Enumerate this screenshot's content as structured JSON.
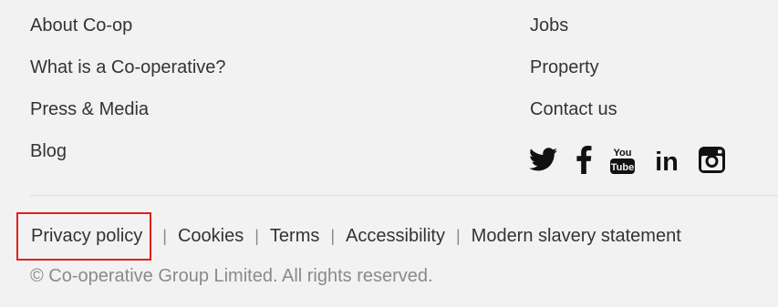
{
  "footer": {
    "left_links": [
      {
        "label": "About Co-op"
      },
      {
        "label": "What is a Co-operative?"
      },
      {
        "label": "Press & Media"
      },
      {
        "label": "Blog"
      }
    ],
    "right_links": [
      {
        "label": "Jobs"
      },
      {
        "label": "Property"
      },
      {
        "label": "Contact us"
      }
    ],
    "social": [
      {
        "icon": "twitter-icon"
      },
      {
        "icon": "facebook-icon"
      },
      {
        "icon": "youtube-icon"
      },
      {
        "icon": "linkedin-icon"
      },
      {
        "icon": "instagram-icon"
      }
    ],
    "youtube_text_top": "You",
    "youtube_text_bottom": "Tube",
    "linkedin_text": "in",
    "legal_links": [
      {
        "label": "Privacy policy"
      },
      {
        "label": "Cookies"
      },
      {
        "label": "Terms"
      },
      {
        "label": "Accessibility"
      },
      {
        "label": "Modern slavery statement"
      }
    ],
    "separator": "|",
    "copyright": "© Co-operative Group Limited. All rights reserved."
  },
  "colors": {
    "background": "#f2f2f2",
    "text": "#333333",
    "muted_text": "#8a8a8a",
    "highlight_border": "#e0201c"
  }
}
